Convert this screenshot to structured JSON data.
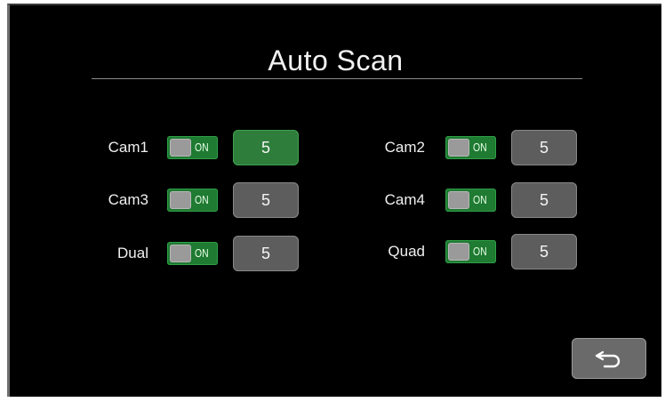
{
  "title": "Auto Scan",
  "rows": [
    {
      "label": "Cam1",
      "toggle": "ON",
      "value": "5",
      "active": true
    },
    {
      "label": "Cam2",
      "toggle": "ON",
      "value": "5",
      "active": false
    },
    {
      "label": "Cam3",
      "toggle": "ON",
      "value": "5",
      "active": false
    },
    {
      "label": "Cam4",
      "toggle": "ON",
      "value": "5",
      "active": false
    },
    {
      "label": "Dual",
      "toggle": "ON",
      "value": "5",
      "active": false
    },
    {
      "label": "Quad",
      "toggle": "ON",
      "value": "5",
      "active": false
    }
  ],
  "back_icon": "return-arrow-icon",
  "colors": {
    "accent": "#2e7d3b",
    "button": "#5d5d5d",
    "background": "#000000"
  }
}
